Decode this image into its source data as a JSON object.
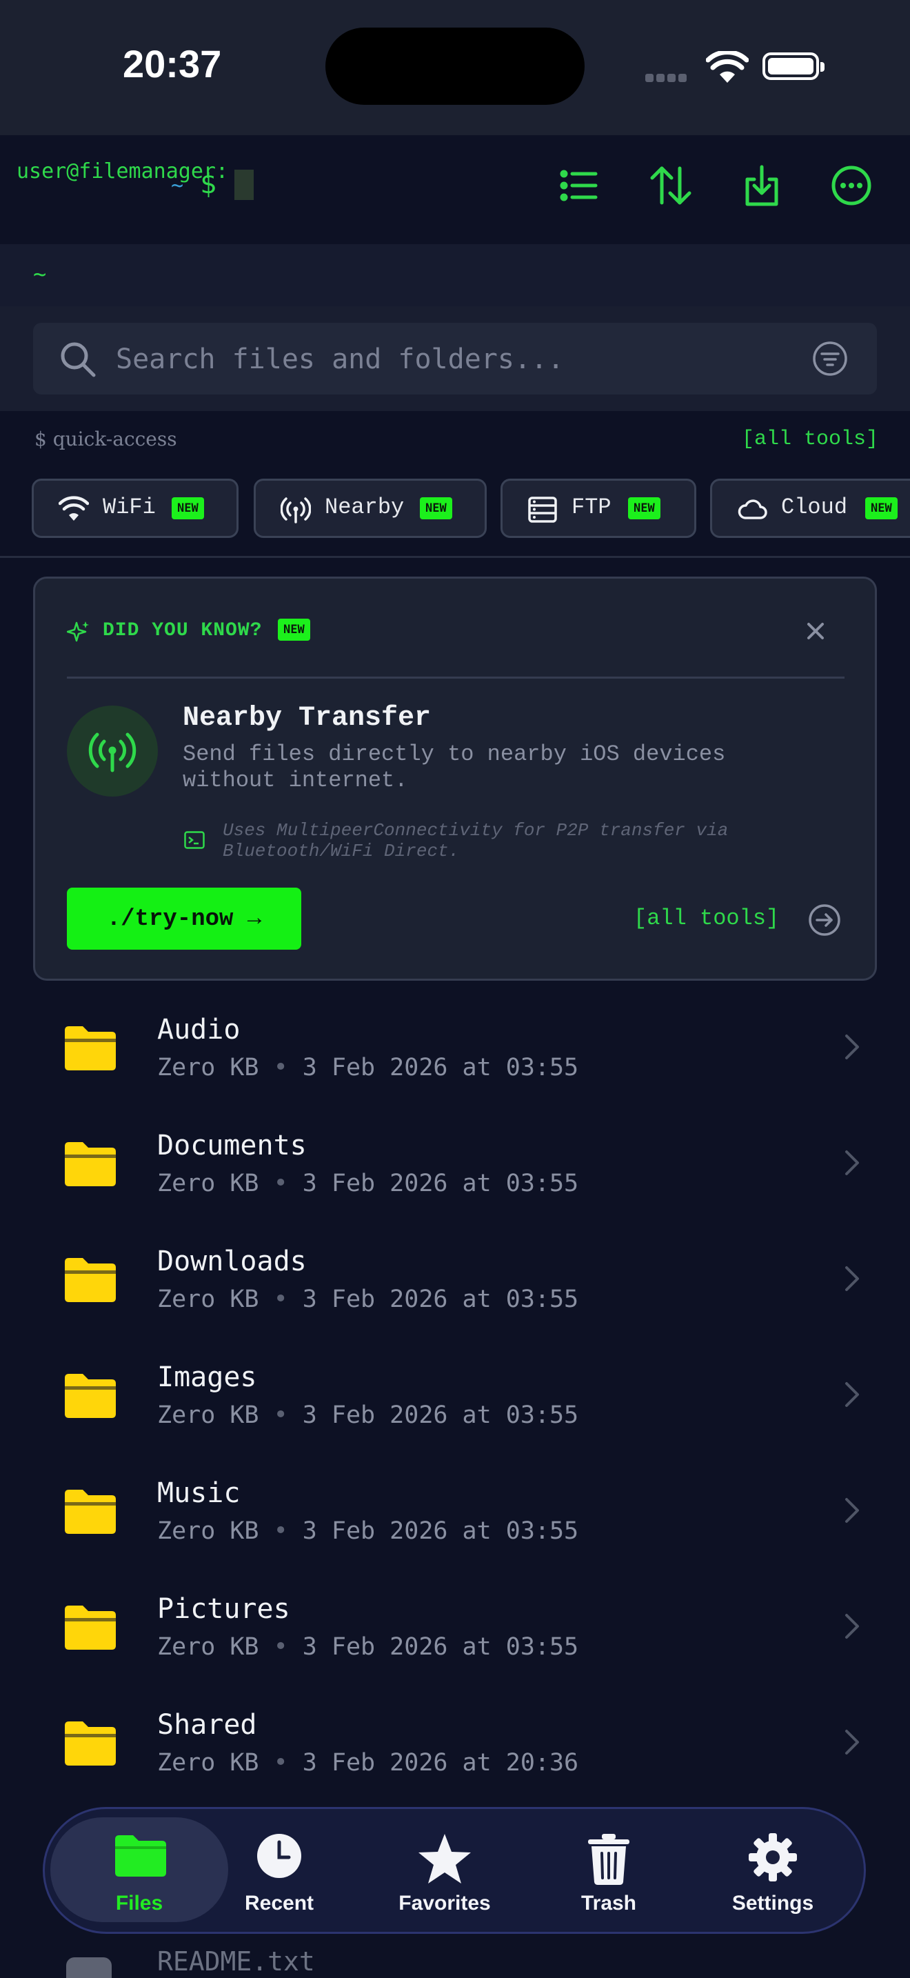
{
  "status_bar": {
    "time": "20:37"
  },
  "header": {
    "prompt_user": "user@filemanager:",
    "prompt_tilde": "~",
    "prompt_dollar": "$",
    "icons": [
      "list-icon",
      "sort-icon",
      "download-icon",
      "more-icon"
    ]
  },
  "path": "~",
  "search": {
    "placeholder": "Search files and folders...",
    "value": ""
  },
  "quick_access": {
    "title": "$ quick-access",
    "all_tools": "[all tools]",
    "chips": [
      {
        "label": "WiFi",
        "icon": "wifi-icon",
        "badge": "NEW"
      },
      {
        "label": "Nearby",
        "icon": "broadcast-icon",
        "badge": "NEW"
      },
      {
        "label": "FTP",
        "icon": "server-icon",
        "badge": "NEW"
      },
      {
        "label": "Cloud",
        "icon": "cloud-icon",
        "badge": "NEW"
      }
    ]
  },
  "tip_card": {
    "heading": "DID YOU KNOW?",
    "badge": "NEW",
    "title": "Nearby Transfer",
    "description": "Send files directly to nearby iOS devices without internet.",
    "note": "Uses MultipeerConnectivity for P2P transfer via Bluetooth/WiFi Direct.",
    "button": "./try-now →",
    "all_tools": "[all tools]"
  },
  "files": [
    {
      "name": "Audio",
      "size": "Zero KB",
      "date": "3 Feb 2026 at 03:55"
    },
    {
      "name": "Documents",
      "size": "Zero KB",
      "date": "3 Feb 2026 at 03:55"
    },
    {
      "name": "Downloads",
      "size": "Zero KB",
      "date": "3 Feb 2026 at 03:55"
    },
    {
      "name": "Images",
      "size": "Zero KB",
      "date": "3 Feb 2026 at 03:55"
    },
    {
      "name": "Music",
      "size": "Zero KB",
      "date": "3 Feb 2026 at 03:55"
    },
    {
      "name": "Pictures",
      "size": "Zero KB",
      "date": "3 Feb 2026 at 03:55"
    },
    {
      "name": "Shared",
      "size": "Zero KB",
      "date": "3 Feb 2026 at 20:36"
    }
  ],
  "meta_separator": "•",
  "partial_file": "README.txt",
  "tabs": [
    {
      "label": "Files",
      "icon": "folder-icon",
      "active": true
    },
    {
      "label": "Recent",
      "icon": "clock-icon",
      "active": false
    },
    {
      "label": "Favorites",
      "icon": "star-icon",
      "active": false
    },
    {
      "label": "Trash",
      "icon": "trash-icon",
      "active": false
    },
    {
      "label": "Settings",
      "icon": "gear-icon",
      "active": false
    }
  ],
  "colors": {
    "accent_green": "#2fd94b",
    "badge_green": "#1cf01c",
    "folder_yellow": "#ffd60a",
    "background": "#0d1124"
  }
}
